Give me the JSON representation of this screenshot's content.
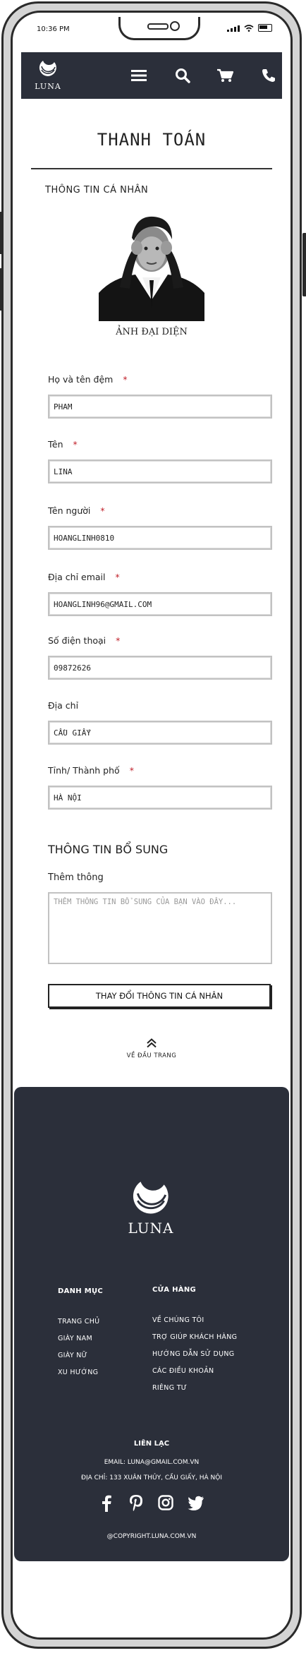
{
  "status_bar": {
    "time": "10:36 PM"
  },
  "header": {
    "logo_text": "LUNA",
    "icons": [
      "menu-icon",
      "search-icon",
      "cart-icon",
      "phone-icon"
    ]
  },
  "page": {
    "title": "THANH TOÁN",
    "personal_section": "THÔNG TIN CÁ NHÂN",
    "avatar_label": "ẢNH ĐẠI DIỆN",
    "required_mark": "*",
    "fields": [
      {
        "label": "Họ và tên đệm",
        "value": "PHAM",
        "required": true
      },
      {
        "label": "Tên",
        "value": "LINA",
        "required": true
      },
      {
        "label": "Tên người",
        "value": "HOANGLINH0810",
        "required": true
      },
      {
        "label": "Địa chỉ email",
        "value": "HOANGLINH96@GMAIL.COM",
        "required": true
      },
      {
        "label": "Số điện thoại",
        "value": "09872626",
        "required": true
      },
      {
        "label": "Địa chỉ",
        "value": "CẦU GIẤY",
        "required": false
      },
      {
        "label": "Tỉnh/ Thành phố",
        "value": "HÀ NỘI",
        "required": true
      }
    ],
    "extra_section": "THÔNG TIN BỔ SUNG",
    "note_label": "Thêm thông",
    "note_placeholder": "THÊM THÔNG TIN BỔ SUNG CỦA BẠN VÀO ĐÂY...",
    "change_button": "THAY ĐỔI THÔNG TIN CÁ NHÂN",
    "back_to_top": "VỀ ĐẦU TRANG"
  },
  "footer": {
    "logo_text": "LUNA",
    "col1": {
      "title": "DANH MỤC",
      "items": [
        "TRANG CHỦ",
        "GIÀY NAM",
        "GIÀY NỮ",
        "XU HƯỚNG"
      ]
    },
    "col2": {
      "title": "CỬA HÀNG",
      "items": [
        "VỀ CHÚNG TÔI",
        "TRỢ GIÚP KHÁCH HÀNG",
        "HƯỚNG DẪN SỬ DỤNG",
        "CÁC ĐIỀU KHOẢN",
        "RIÊNG TƯ"
      ]
    },
    "contact": {
      "title": "LIÊN LẠC",
      "email": "EMAIL: LUNA@GMAIL.COM.VN",
      "address": "ĐỊA CHỈ: 133 XUÂN THỦY, CẦU GIẤY, HÀ NỘI"
    },
    "socials": [
      "facebook-icon",
      "pinterest-icon",
      "instagram-icon",
      "twitter-icon"
    ],
    "copyright": "@COPYRIGHT.LUNA.COM.VN"
  },
  "colors": {
    "dark": "#2b2f3a",
    "required": "#c0202a",
    "frame": "#d4d4d4"
  }
}
